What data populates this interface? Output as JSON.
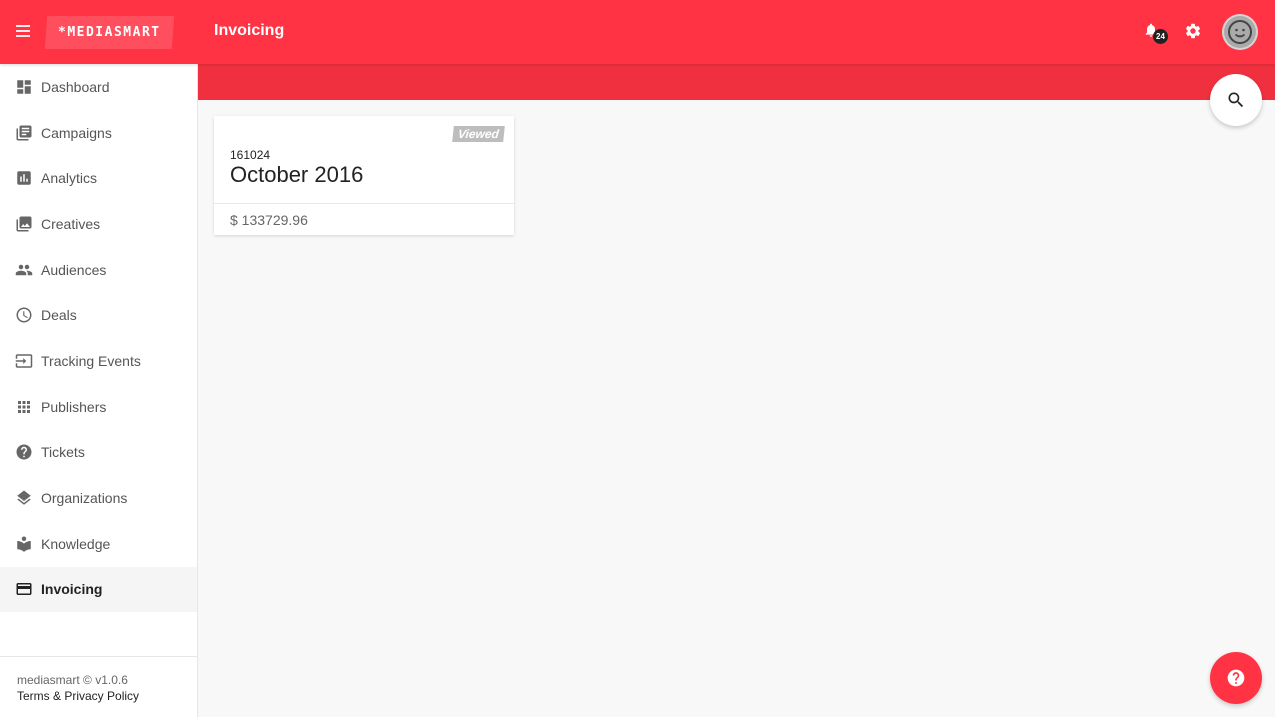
{
  "header": {
    "logo_text": "*MEDIASMART",
    "title": "Invoicing",
    "notifications_count": "24",
    "icons": {
      "menu": "hamburger-icon",
      "notifications": "bell-icon",
      "settings": "gear-icon",
      "avatar": "smiley-face-avatar"
    }
  },
  "sidebar": {
    "items": [
      {
        "label": "Dashboard",
        "icon": "dashboard-icon",
        "active": false
      },
      {
        "label": "Campaigns",
        "icon": "library-books-icon",
        "active": false
      },
      {
        "label": "Analytics",
        "icon": "bar-chart-icon",
        "active": false
      },
      {
        "label": "Creatives",
        "icon": "photo-library-icon",
        "active": false
      },
      {
        "label": "Audiences",
        "icon": "people-icon",
        "active": false
      },
      {
        "label": "Deals",
        "icon": "clock-icon",
        "active": false
      },
      {
        "label": "Tracking Events",
        "icon": "input-icon",
        "active": false
      },
      {
        "label": "Publishers",
        "icon": "apps-grid-icon",
        "active": false
      },
      {
        "label": "Tickets",
        "icon": "help-circle-icon",
        "active": false
      },
      {
        "label": "Organizations",
        "icon": "layers-icon",
        "active": false
      },
      {
        "label": "Knowledge",
        "icon": "book-reader-icon",
        "active": false
      },
      {
        "label": "Invoicing",
        "icon": "credit-card-icon",
        "active": true
      }
    ],
    "footer": {
      "version": "mediasmart © v1.0.6",
      "terms": "Terms & Privacy Policy"
    }
  },
  "invoices": [
    {
      "number": "161024",
      "period": "October 2016",
      "amount": "$ 133729.96",
      "status": "Viewed"
    }
  ],
  "fabs": {
    "search": "search-icon",
    "help": "help-icon"
  },
  "colors": {
    "brand": "#ff3344",
    "band": "#f1303f",
    "badge": "#222222",
    "viewed": "#bdbdbd"
  }
}
